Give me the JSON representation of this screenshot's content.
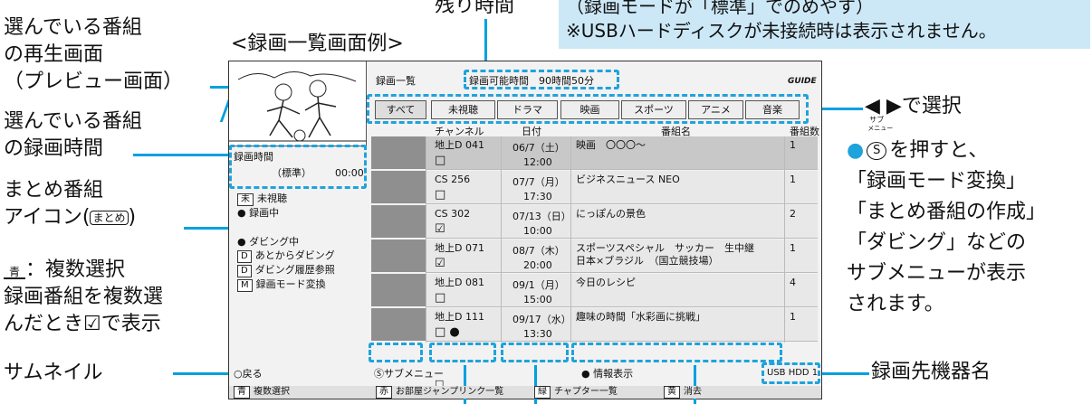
{
  "top_note": {
    "line1": "（録画モードが「標準」でのめやす）",
    "line2": "※USBハードディスクが未接続時は表示されません。"
  },
  "callouts": {
    "remaining_time": "残り時間",
    "example_title": "<録画一覧画面例>",
    "preview_1": "選んでいる番組",
    "preview_2": "の再生画面",
    "preview_3": "（プレビュー画面）",
    "rectime_1": "選んでいる番組",
    "rectime_2": "の録画時間",
    "summary_1": "まとめ番組",
    "summary_2": "アイコン(",
    "summary_icon": "まとめ",
    "summary_3": ")",
    "multi_key": "青",
    "multi_1": "：複数選択",
    "multi_2": "録画番組を複数選",
    "multi_3": "んだとき☑で表示",
    "thumbnail": "サムネイル",
    "select": "◀ ▶で選択",
    "sub_key_top": "サブ",
    "sub_key_mid": "メニュー",
    "sub_key": "S",
    "sub_1": "を押すと、",
    "sub_2": "「録画モード変換」",
    "sub_3": "「まとめ番組の作成」",
    "sub_4": "「ダビング」などの",
    "sub_5": "サブメニューが表示",
    "sub_6": "されます。",
    "device": "録画先機器名"
  },
  "screen": {
    "title": "録画一覧",
    "remaining_label": "録画可能時間",
    "remaining_value": "90時間50分",
    "logo": "GUIDE",
    "tabs": [
      "すべて",
      "未視聴",
      "ドラマ",
      "映画",
      "スポーツ",
      "アニメ",
      "音楽"
    ],
    "headers": {
      "channel": "チャンネル",
      "date": "日付",
      "name": "番組名",
      "number": "番組数"
    },
    "rec_time_label": "録画時間",
    "rec_mode": "（標準）",
    "rec_time": "00:00",
    "menu": [
      "未視聴",
      "● 録画中",
      "● ダビング中",
      "あとからダビング",
      "ダビング履歴参照",
      "録画モード変換"
    ],
    "menu_keys": [
      "未",
      "",
      "",
      "D",
      "D",
      "M"
    ],
    "rows": [
      {
        "channel": "地上D 041",
        "date": "06/7（土）",
        "time": "12:00",
        "name": "映画　〇〇〇〜",
        "count": "1",
        "mark": "□"
      },
      {
        "channel": "CS 256",
        "date": "07/7（月）",
        "time": "17:30",
        "name": "ビジネスニュース NEO",
        "count": "1",
        "mark": "□"
      },
      {
        "channel": "CS 302",
        "date": "07/13（日）",
        "time": "10:00",
        "name": "にっぽんの景色",
        "count": "2",
        "mark": "☑"
      },
      {
        "channel": "地上D 071",
        "date": "08/7（木）",
        "time": "20:00",
        "name": "スポーツスペシャル　サッカー　生中継",
        "name2": "日本×ブラジル　（国立競技場）",
        "count": "1",
        "mark": "☑"
      },
      {
        "channel": "地上D 081",
        "date": "09/1（月）",
        "time": "15:00",
        "name": "今日のレシピ",
        "count": "4",
        "mark": "□"
      },
      {
        "channel": "地上D 111",
        "date": "09/17（水）",
        "time": "13:30",
        "name": "趣味の時間「水彩画に挑戦」",
        "count": "1",
        "mark": "□ ●"
      }
    ],
    "last_mark": "□",
    "footer_back": "○戻る",
    "footer_sub": "Ⓢサブメニュー",
    "footer_info": "情報表示",
    "device": "USB HDD 1",
    "bottom": [
      {
        "key": "青",
        "label": "複数選択"
      },
      {
        "key": "赤",
        "label": "お部屋ジャンプリンク一覧"
      },
      {
        "key": "緑",
        "label": "チャプター一覧"
      },
      {
        "key": "黄",
        "label": "消去"
      }
    ]
  },
  "colors": {
    "accent": "#00a0e0",
    "note_bg": "#cce8f7"
  }
}
